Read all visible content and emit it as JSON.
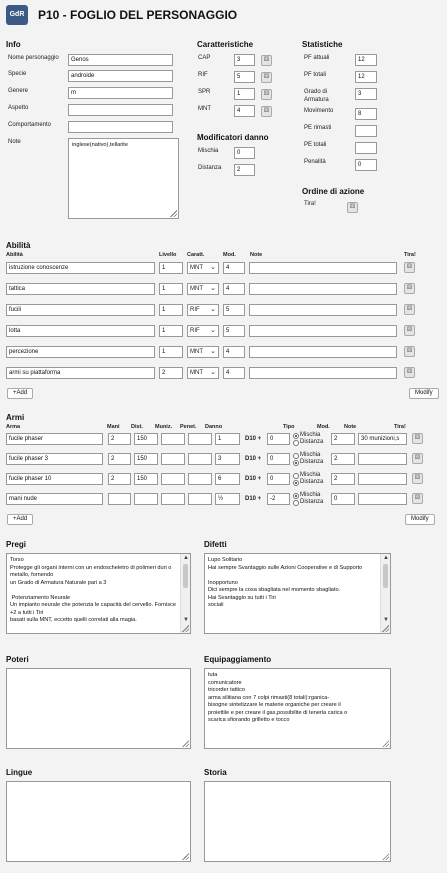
{
  "header": {
    "logo": "GdR",
    "title": "P10 - FOGLIO DEL PERSONAGGIO"
  },
  "info": {
    "heading": "Info",
    "name_label": "Nome personaggio",
    "name": "Genos",
    "species_label": "Specie",
    "species": "androide",
    "gender_label": "Genere",
    "gender": "m",
    "look_label": "Aspetto",
    "look": "",
    "behavior_label": "Comportamento",
    "behavior": "",
    "notes_label": "Note",
    "notes": "inglese(nativo),tellarite"
  },
  "chars": {
    "heading": "Caratteristiche",
    "items": [
      {
        "label": "CAP",
        "value": "3"
      },
      {
        "label": "RIF",
        "value": "5"
      },
      {
        "label": "SPR",
        "value": "1"
      },
      {
        "label": "MNT",
        "value": "4"
      }
    ]
  },
  "damage_mods": {
    "heading": "Modificatori danno",
    "melee_label": "Mischia",
    "melee": "0",
    "ranged_label": "Distanza",
    "ranged": "2"
  },
  "stats": {
    "heading": "Statistiche",
    "hp_cur_label": "PF attuali",
    "hp_cur": "12",
    "hp_tot_label": "PF totali",
    "hp_tot": "12",
    "armor_label": "Grado di Armatura",
    "armor": "3",
    "move_label": "Movimento",
    "move": "8",
    "pe_rem_label": "PE rimasti",
    "pe_rem": "",
    "pe_tot_label": "PE totali",
    "pe_tot": "",
    "pen_label": "Penalità",
    "pen": "0"
  },
  "order": {
    "heading": "Ordine di azione",
    "roll_label": "Tira!"
  },
  "skills": {
    "heading": "Abilità",
    "cols": {
      "name": "Abilità",
      "level": "Livello",
      "char": "Caratt.",
      "mod": "Mod.",
      "notes": "Note",
      "roll": "Tira!"
    },
    "rows": [
      {
        "name": "istruzione conoscenze",
        "level": "1",
        "char": "MNT",
        "mod": "4",
        "notes": ""
      },
      {
        "name": "tattica",
        "level": "1",
        "char": "MNT",
        "mod": "4",
        "notes": ""
      },
      {
        "name": "fucili",
        "level": "1",
        "char": "RIF",
        "mod": "5",
        "notes": ""
      },
      {
        "name": "lotta",
        "level": "1",
        "char": "RIF",
        "mod": "5",
        "notes": ""
      },
      {
        "name": "percezione",
        "level": "1",
        "char": "MNT",
        "mod": "4",
        "notes": ""
      },
      {
        "name": "armi su piattaforma",
        "level": "2",
        "char": "MNT",
        "mod": "4",
        "notes": ""
      }
    ],
    "add": "+Add",
    "modify": "Modify"
  },
  "weapons": {
    "heading": "Armi",
    "cols": {
      "name": "Arma",
      "hands": "Mani",
      "dist": "Dist.",
      "ammo": "Muniz.",
      "pen": "Penet.",
      "dmg": "Danno",
      "type": "Tipo",
      "mod": "Mod.",
      "notes": "Note",
      "roll": "Tira!"
    },
    "d10": "D10 +",
    "melee": "Mischia",
    "ranged": "Distanza",
    "rows": [
      {
        "name": "fucile phaser",
        "hands": "2",
        "dist": "150",
        "ammo": "",
        "pen": "",
        "dmg": "1",
        "d10": "0",
        "type": "melee",
        "mod": "2",
        "notes": "30 munizioni,s"
      },
      {
        "name": "fucile phaser 3",
        "hands": "2",
        "dist": "150",
        "ammo": "",
        "pen": "",
        "dmg": "3",
        "d10": "0",
        "type": "ranged",
        "mod": "2",
        "notes": ""
      },
      {
        "name": "fucile phaser 10",
        "hands": "2",
        "dist": "150",
        "ammo": "",
        "pen": "",
        "dmg": "6",
        "d10": "0",
        "type": "ranged",
        "mod": "2",
        "notes": ""
      },
      {
        "name": "mani nude",
        "hands": "",
        "dist": "",
        "ammo": "",
        "pen": "",
        "dmg": "½",
        "d10": "-2",
        "type": "melee",
        "mod": "0",
        "notes": ""
      }
    ],
    "add": "+Add",
    "modify": "Modify"
  },
  "merits": {
    "heading": "Pregi",
    "text": "Torso\nProtegge gli organi interni con un endoscheletro di polimeri duri o metallo, fornendo\nun Grado di Armatura Naturale pari a 3\n\n Potenziamento Neurale\nUn impianto neurale che potenzia le capacità del cervello. Fornisce +2 a tutti i Tiri\nbasati sulla MNT, eccetto quelli correlati alla magia."
  },
  "flaws": {
    "heading": "Difetti",
    "text": "Lupo Solitario\nHai sempre Svantaggio sulle Azioni Cooperative e di Supporto\n\nInopportuno\nDici sempre la cosa sbagliata nel momento sbagliato.\nHai Svantaggio su tutti i Tiri\nsociali"
  },
  "powers": {
    "heading": "Poteri",
    "text": ""
  },
  "equipment": {
    "heading": "Equipaggiamento",
    "text": "tuta\ncomunicatore\ntricorder tattico\narma silitiana con 7 colpi rimasti(8 totali):rganica-\nbisogne sintetizzare le materie organiche per creare il\nproiettile e per creare il gas,possibilite di tenerla carica o\nscarica sfiorando grilletto e tocco"
  },
  "languages": {
    "heading": "Lingue",
    "text": ""
  },
  "story": {
    "heading": "Storia",
    "text": ""
  }
}
